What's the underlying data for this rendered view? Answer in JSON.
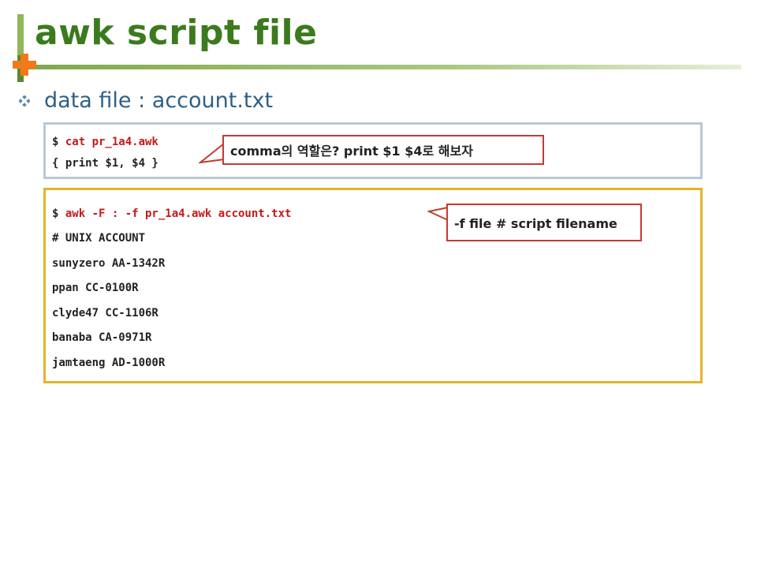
{
  "slide": {
    "title": "awk script file",
    "bullet": "data file : account.txt"
  },
  "box1": {
    "line1_prompt": "$ ",
    "line1_cmd": "cat pr_1a4.awk",
    "line2": "{ print $1, $4 }"
  },
  "callout1": {
    "text": "comma의 역할은? print $1 $4로 해보자"
  },
  "box2": {
    "cmd_prompt": "$ ",
    "cmd": "awk -F : -f pr_1a4.awk account.txt",
    "output": [
      "# UNIX ACCOUNT",
      "sunyzero AA-1342R",
      "ppan CC-0100R",
      "clyde47 CC-1106R",
      "banaba CA-0971R",
      "jamtaeng AD-1000R"
    ]
  },
  "callout2": {
    "text": "-f file # script filename"
  },
  "colors": {
    "title_green": "#3c7a1e",
    "subtitle_blue": "#2f5f86",
    "command_red": "#c21a1a",
    "callout_border": "#c53a2e",
    "box1_border": "#b8c8d4",
    "box2_border": "#e2b52a",
    "accent_orange": "#f07a1a"
  },
  "icons": {
    "title_ornament": "green-bar-orange-cross",
    "bullet": "four-diamond-bullet-icon"
  }
}
